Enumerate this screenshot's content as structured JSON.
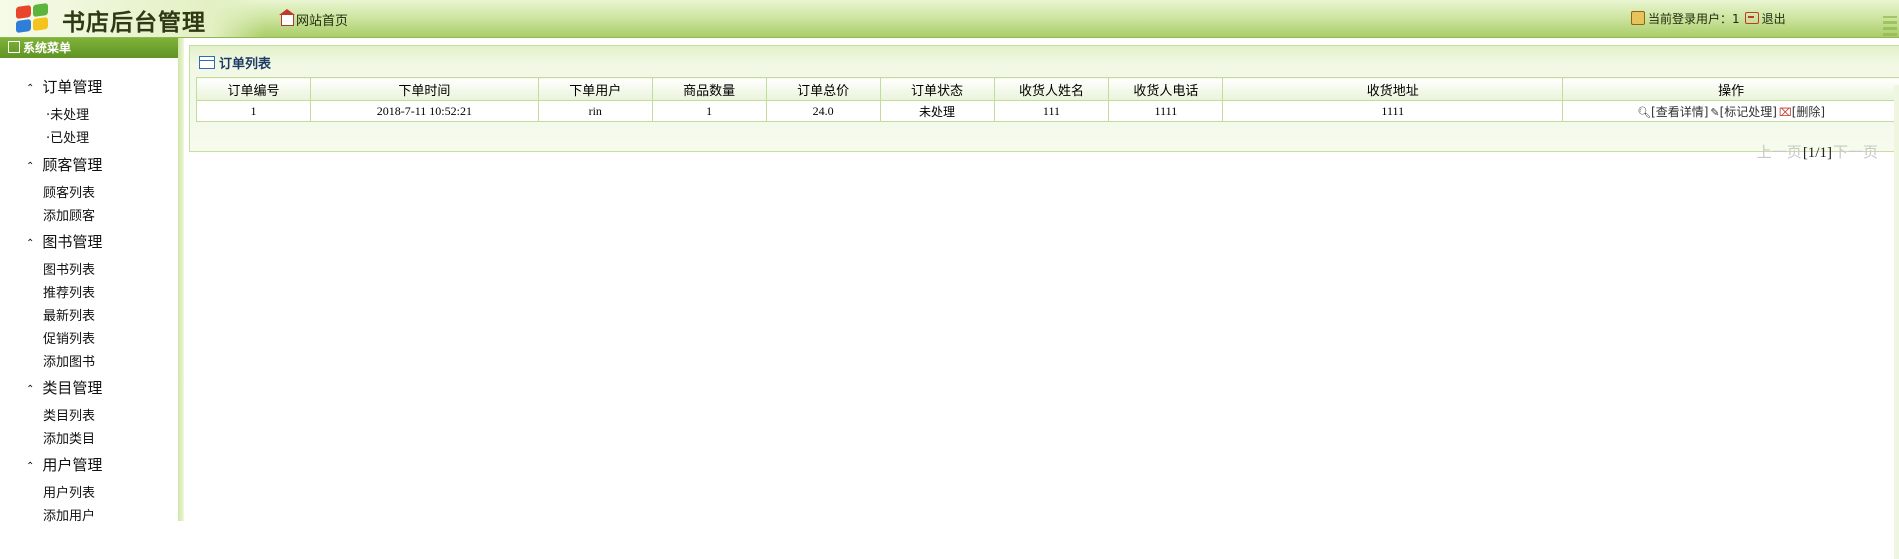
{
  "header": {
    "app_title": "书店后台管理",
    "home_link": "网站首页",
    "login_label": "当前登录用户：",
    "login_user": "1",
    "logout_label": "退出"
  },
  "sidebar": {
    "title": "系统菜单",
    "groups": [
      {
        "label": "订单管理",
        "items": [
          "·未处理",
          "·已处理"
        ]
      },
      {
        "label": "顾客管理",
        "items": [
          "顾客列表",
          "添加顾客"
        ]
      },
      {
        "label": "图书管理",
        "items": [
          "图书列表",
          "推荐列表",
          "最新列表",
          "促销列表",
          "添加图书"
        ]
      },
      {
        "label": "类目管理",
        "items": [
          "类目列表",
          "添加类目"
        ]
      },
      {
        "label": "用户管理",
        "items": [
          "用户列表",
          "添加用户"
        ]
      }
    ]
  },
  "main": {
    "panel_title": "订单列表",
    "columns": [
      "订单编号",
      "下单时间",
      "下单用户",
      "商品数量",
      "订单总价",
      "订单状态",
      "收货人姓名",
      "收货人电话",
      "收货地址",
      "操作"
    ],
    "rows": [
      {
        "id": "1",
        "time": "2018-7-11 10:52:21",
        "user": "rin",
        "qty": "1",
        "total": "24.0",
        "status": "未处理",
        "receiver_name": "111",
        "receiver_phone": "1111",
        "address": "1111",
        "actions": {
          "view": "[查看详情]",
          "mark": "[标记处理]",
          "delete": "[删除]"
        }
      }
    ],
    "pager": {
      "prev": "上一页",
      "current": "[1/1]",
      "next": "下一页"
    }
  },
  "colors": {
    "header_green": "#a9cd68",
    "menu_header": "#5f9424",
    "border": "#c2dc9c",
    "title_blue": "#1e3a66"
  }
}
